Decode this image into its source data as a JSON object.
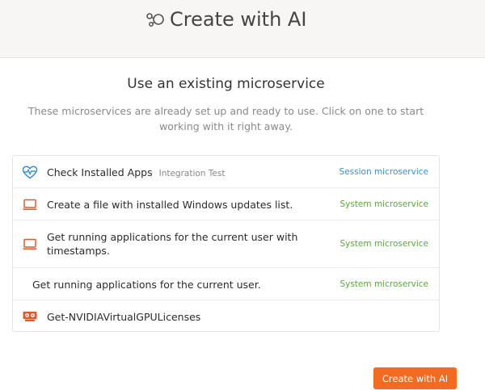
{
  "header": {
    "title": "Create with AI",
    "icon": "nodes-icon"
  },
  "section": {
    "title": "Use an existing microservice",
    "description": "These microservices are already set up and ready to use. Click on one to start working with it right away."
  },
  "microservices": [
    {
      "label": "Check Installed Apps",
      "tag": "Integration Test",
      "type": "Session microservice",
      "icon": "heart-pulse-icon"
    },
    {
      "label": "Create a file with installed Windows updates list.",
      "tag": "",
      "type": "System microservice",
      "icon": "laptop-icon"
    },
    {
      "label": "Get running applications for the current user with timestamps.",
      "tag": "",
      "type": "System microservice",
      "icon": "laptop-icon"
    },
    {
      "label": "Get running applications for the current user.",
      "tag": "",
      "type": "System microservice",
      "icon": ""
    },
    {
      "label": "Get-NVIDIAVirtualGPULicenses",
      "tag": "",
      "type": "",
      "icon": "gpu-card-icon"
    }
  ],
  "cta": {
    "label": "Create with AI"
  },
  "colors": {
    "accent": "#f26b21",
    "session": "#3b8fd0",
    "system": "#5aa83c",
    "icon": "#e05a2b"
  }
}
